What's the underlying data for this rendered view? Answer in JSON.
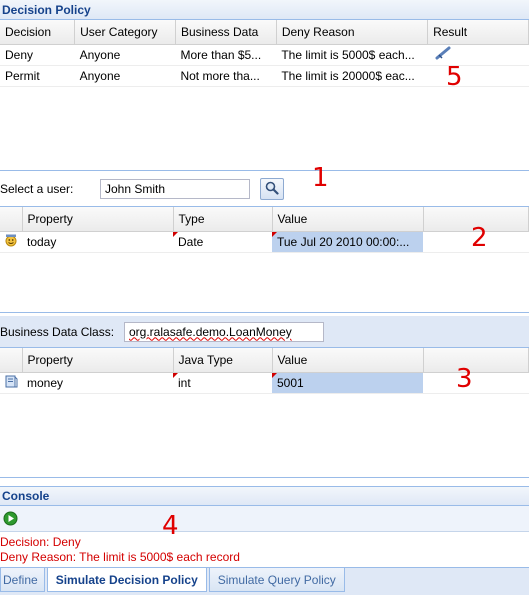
{
  "policy": {
    "title": "Decision Policy",
    "columns": [
      "Decision",
      "User Category",
      "Business Data",
      "Deny Reason",
      "Result"
    ],
    "rows": [
      [
        "Deny",
        "Anyone",
        "More than $5...",
        "The limit is 5000$ each...",
        ""
      ],
      [
        "Permit",
        "Anyone",
        "Not more tha...",
        "The limit is 20000$ eac...",
        ""
      ]
    ]
  },
  "user": {
    "label": "Select a user:",
    "value": "John Smith"
  },
  "properties": {
    "columns": [
      "Property",
      "Type",
      "Value"
    ],
    "rows": [
      [
        "today",
        "Date",
        "Tue Jul 20 2010 00:00:..."
      ]
    ]
  },
  "business": {
    "label": "Business Data Class:",
    "value": "org.ralasafe.demo.LoanMoney",
    "columns": [
      "Property",
      "Java Type",
      "Value"
    ],
    "rows": [
      [
        "money",
        "int",
        "5001"
      ]
    ]
  },
  "console": {
    "title": "Console",
    "line1": "Decision: Deny",
    "line2": "Deny Reason: The limit is 5000$ each record"
  },
  "annotations": [
    "1",
    "2",
    "3",
    "4",
    "5"
  ],
  "tabs": [
    "Define",
    "Simulate Decision Policy",
    "Simulate Query Policy"
  ]
}
